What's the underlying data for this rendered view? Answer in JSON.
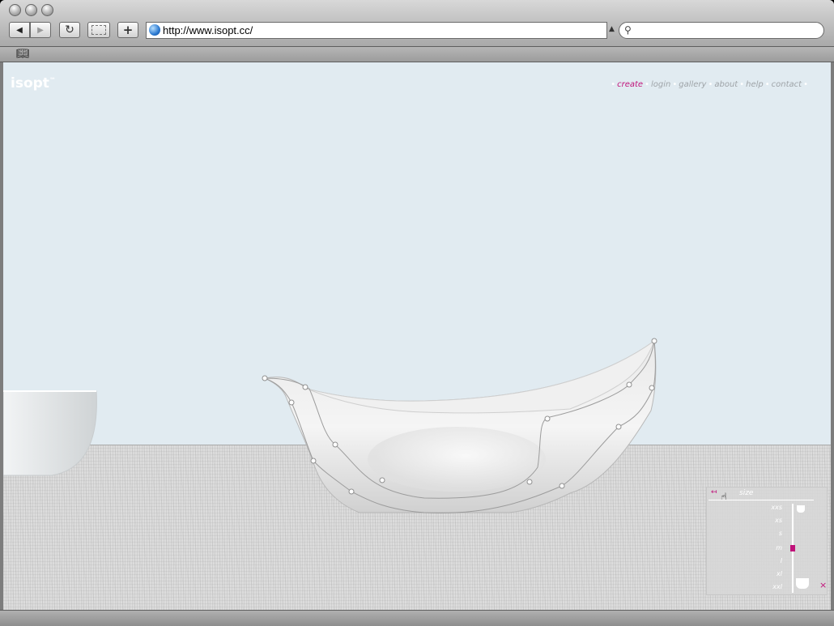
{
  "browser": {
    "url": "http://www.isopt.cc/"
  },
  "site": {
    "logo": "isopt",
    "logo_mark": "™",
    "nav": [
      {
        "label": "create",
        "active": true
      },
      {
        "label": "login",
        "active": false
      },
      {
        "label": "gallery",
        "active": false
      },
      {
        "label": "about",
        "active": false
      },
      {
        "label": "help",
        "active": false
      },
      {
        "label": "contact",
        "active": false
      }
    ]
  },
  "size_panel": {
    "title": "size",
    "sizes": [
      "xxs",
      "xs",
      "s",
      "m",
      "l",
      "xl",
      "xxl"
    ],
    "selected": "m",
    "close_glyph": "×"
  },
  "colors": {
    "accent": "#c0137a",
    "background": "#e1ebf1",
    "nav_inactive": "#9fa4a8"
  }
}
